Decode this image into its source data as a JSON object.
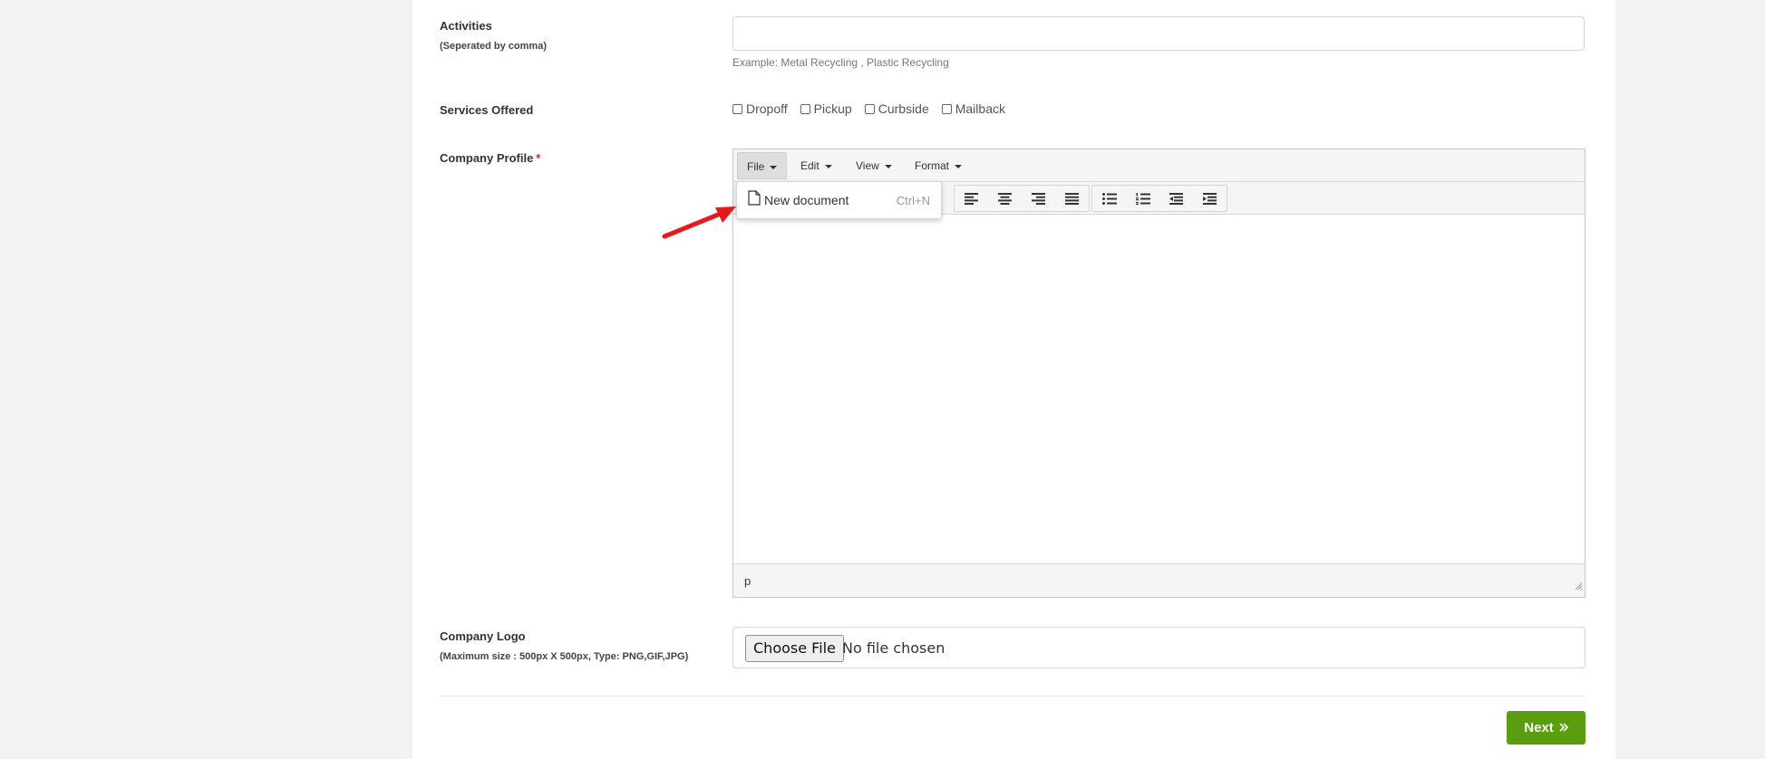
{
  "form": {
    "activities": {
      "label": "Activities",
      "sublabel": "(Seperated by comma)",
      "value": "",
      "help": "Example: Metal Recycling , Plastic Recycling"
    },
    "services": {
      "label": "Services Offered",
      "options": [
        "Dropoff",
        "Pickup",
        "Curbside",
        "Mailback"
      ]
    },
    "profile": {
      "label": "Company Profile",
      "required_mark": "*"
    },
    "logo": {
      "label": "Company Logo",
      "sublabel": "(Maximum size : 500px X 500px, Type: PNG,GIF,JPG)",
      "button": "Choose File",
      "status": "No file chosen"
    },
    "next_label": "Next"
  },
  "editor": {
    "menus": [
      "File",
      "Edit",
      "View",
      "Format"
    ],
    "active_menu": "File",
    "dropdown": {
      "item_label": "New document",
      "item_shortcut": "Ctrl+N",
      "icon": "document-icon"
    },
    "toolbar_icons": [
      "align-left-icon",
      "align-center-icon",
      "align-right-icon",
      "align-justify-icon",
      "bullet-list-icon",
      "numbered-list-icon",
      "outdent-icon",
      "indent-icon"
    ],
    "status_path": "p"
  },
  "colors": {
    "accent_green": "#5a9e0f",
    "required_red": "#e02020",
    "annotation_arrow": "#e8191b"
  }
}
